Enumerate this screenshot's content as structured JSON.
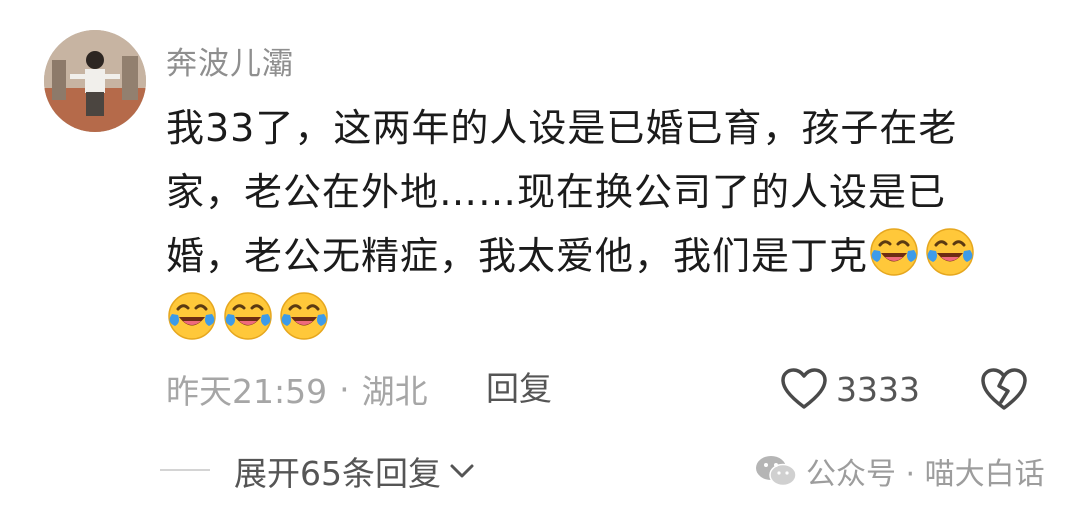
{
  "comment": {
    "username": "奔波儿灞",
    "text_line1": "我33了，这两年的人设是已婚已育，孩子在老",
    "text_line2": "家，老公在外地……现在换公司了的人设是已",
    "text_line3": "婚，老公无精症，我太爱他，我们是丁克",
    "emoji_icon": "laughing-crying-emoji",
    "time": "昨天21:59",
    "separator": "·",
    "location": "湖北",
    "reply_label": "回复",
    "like_count": "3333"
  },
  "thread": {
    "expand_label": "展开65条回复"
  },
  "watermark": {
    "text": "公众号 · 喵大白话"
  },
  "colors": {
    "username": "#8f8f8f",
    "body_text": "#1b1b1b",
    "meta_text": "#a6a6a6",
    "emoji_yellow": "#ffc83a",
    "emoji_tear": "#3d9be9"
  }
}
